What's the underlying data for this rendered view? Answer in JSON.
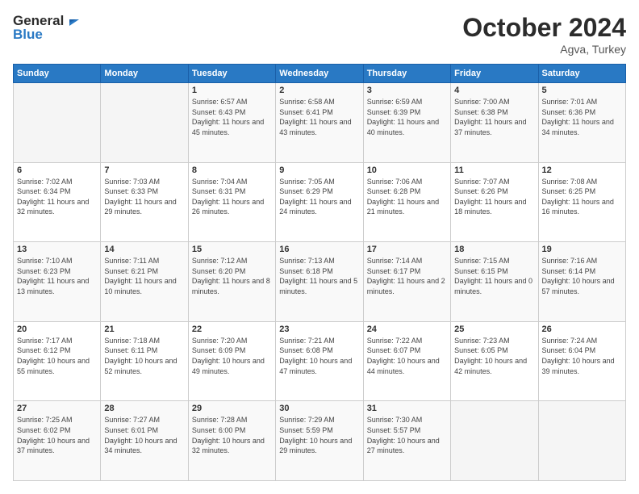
{
  "logo": {
    "line1": "General",
    "line2": "Blue"
  },
  "header": {
    "month": "October 2024",
    "location": "Agva, Turkey"
  },
  "weekdays": [
    "Sunday",
    "Monday",
    "Tuesday",
    "Wednesday",
    "Thursday",
    "Friday",
    "Saturday"
  ],
  "weeks": [
    [
      {
        "day": "",
        "sunrise": "",
        "sunset": "",
        "daylight": ""
      },
      {
        "day": "",
        "sunrise": "",
        "sunset": "",
        "daylight": ""
      },
      {
        "day": "1",
        "sunrise": "Sunrise: 6:57 AM",
        "sunset": "Sunset: 6:43 PM",
        "daylight": "Daylight: 11 hours and 45 minutes."
      },
      {
        "day": "2",
        "sunrise": "Sunrise: 6:58 AM",
        "sunset": "Sunset: 6:41 PM",
        "daylight": "Daylight: 11 hours and 43 minutes."
      },
      {
        "day": "3",
        "sunrise": "Sunrise: 6:59 AM",
        "sunset": "Sunset: 6:39 PM",
        "daylight": "Daylight: 11 hours and 40 minutes."
      },
      {
        "day": "4",
        "sunrise": "Sunrise: 7:00 AM",
        "sunset": "Sunset: 6:38 PM",
        "daylight": "Daylight: 11 hours and 37 minutes."
      },
      {
        "day": "5",
        "sunrise": "Sunrise: 7:01 AM",
        "sunset": "Sunset: 6:36 PM",
        "daylight": "Daylight: 11 hours and 34 minutes."
      }
    ],
    [
      {
        "day": "6",
        "sunrise": "Sunrise: 7:02 AM",
        "sunset": "Sunset: 6:34 PM",
        "daylight": "Daylight: 11 hours and 32 minutes."
      },
      {
        "day": "7",
        "sunrise": "Sunrise: 7:03 AM",
        "sunset": "Sunset: 6:33 PM",
        "daylight": "Daylight: 11 hours and 29 minutes."
      },
      {
        "day": "8",
        "sunrise": "Sunrise: 7:04 AM",
        "sunset": "Sunset: 6:31 PM",
        "daylight": "Daylight: 11 hours and 26 minutes."
      },
      {
        "day": "9",
        "sunrise": "Sunrise: 7:05 AM",
        "sunset": "Sunset: 6:29 PM",
        "daylight": "Daylight: 11 hours and 24 minutes."
      },
      {
        "day": "10",
        "sunrise": "Sunrise: 7:06 AM",
        "sunset": "Sunset: 6:28 PM",
        "daylight": "Daylight: 11 hours and 21 minutes."
      },
      {
        "day": "11",
        "sunrise": "Sunrise: 7:07 AM",
        "sunset": "Sunset: 6:26 PM",
        "daylight": "Daylight: 11 hours and 18 minutes."
      },
      {
        "day": "12",
        "sunrise": "Sunrise: 7:08 AM",
        "sunset": "Sunset: 6:25 PM",
        "daylight": "Daylight: 11 hours and 16 minutes."
      }
    ],
    [
      {
        "day": "13",
        "sunrise": "Sunrise: 7:10 AM",
        "sunset": "Sunset: 6:23 PM",
        "daylight": "Daylight: 11 hours and 13 minutes."
      },
      {
        "day": "14",
        "sunrise": "Sunrise: 7:11 AM",
        "sunset": "Sunset: 6:21 PM",
        "daylight": "Daylight: 11 hours and 10 minutes."
      },
      {
        "day": "15",
        "sunrise": "Sunrise: 7:12 AM",
        "sunset": "Sunset: 6:20 PM",
        "daylight": "Daylight: 11 hours and 8 minutes."
      },
      {
        "day": "16",
        "sunrise": "Sunrise: 7:13 AM",
        "sunset": "Sunset: 6:18 PM",
        "daylight": "Daylight: 11 hours and 5 minutes."
      },
      {
        "day": "17",
        "sunrise": "Sunrise: 7:14 AM",
        "sunset": "Sunset: 6:17 PM",
        "daylight": "Daylight: 11 hours and 2 minutes."
      },
      {
        "day": "18",
        "sunrise": "Sunrise: 7:15 AM",
        "sunset": "Sunset: 6:15 PM",
        "daylight": "Daylight: 11 hours and 0 minutes."
      },
      {
        "day": "19",
        "sunrise": "Sunrise: 7:16 AM",
        "sunset": "Sunset: 6:14 PM",
        "daylight": "Daylight: 10 hours and 57 minutes."
      }
    ],
    [
      {
        "day": "20",
        "sunrise": "Sunrise: 7:17 AM",
        "sunset": "Sunset: 6:12 PM",
        "daylight": "Daylight: 10 hours and 55 minutes."
      },
      {
        "day": "21",
        "sunrise": "Sunrise: 7:18 AM",
        "sunset": "Sunset: 6:11 PM",
        "daylight": "Daylight: 10 hours and 52 minutes."
      },
      {
        "day": "22",
        "sunrise": "Sunrise: 7:20 AM",
        "sunset": "Sunset: 6:09 PM",
        "daylight": "Daylight: 10 hours and 49 minutes."
      },
      {
        "day": "23",
        "sunrise": "Sunrise: 7:21 AM",
        "sunset": "Sunset: 6:08 PM",
        "daylight": "Daylight: 10 hours and 47 minutes."
      },
      {
        "day": "24",
        "sunrise": "Sunrise: 7:22 AM",
        "sunset": "Sunset: 6:07 PM",
        "daylight": "Daylight: 10 hours and 44 minutes."
      },
      {
        "day": "25",
        "sunrise": "Sunrise: 7:23 AM",
        "sunset": "Sunset: 6:05 PM",
        "daylight": "Daylight: 10 hours and 42 minutes."
      },
      {
        "day": "26",
        "sunrise": "Sunrise: 7:24 AM",
        "sunset": "Sunset: 6:04 PM",
        "daylight": "Daylight: 10 hours and 39 minutes."
      }
    ],
    [
      {
        "day": "27",
        "sunrise": "Sunrise: 7:25 AM",
        "sunset": "Sunset: 6:02 PM",
        "daylight": "Daylight: 10 hours and 37 minutes."
      },
      {
        "day": "28",
        "sunrise": "Sunrise: 7:27 AM",
        "sunset": "Sunset: 6:01 PM",
        "daylight": "Daylight: 10 hours and 34 minutes."
      },
      {
        "day": "29",
        "sunrise": "Sunrise: 7:28 AM",
        "sunset": "Sunset: 6:00 PM",
        "daylight": "Daylight: 10 hours and 32 minutes."
      },
      {
        "day": "30",
        "sunrise": "Sunrise: 7:29 AM",
        "sunset": "Sunset: 5:59 PM",
        "daylight": "Daylight: 10 hours and 29 minutes."
      },
      {
        "day": "31",
        "sunrise": "Sunrise: 7:30 AM",
        "sunset": "Sunset: 5:57 PM",
        "daylight": "Daylight: 10 hours and 27 minutes."
      },
      {
        "day": "",
        "sunrise": "",
        "sunset": "",
        "daylight": ""
      },
      {
        "day": "",
        "sunrise": "",
        "sunset": "",
        "daylight": ""
      }
    ]
  ]
}
